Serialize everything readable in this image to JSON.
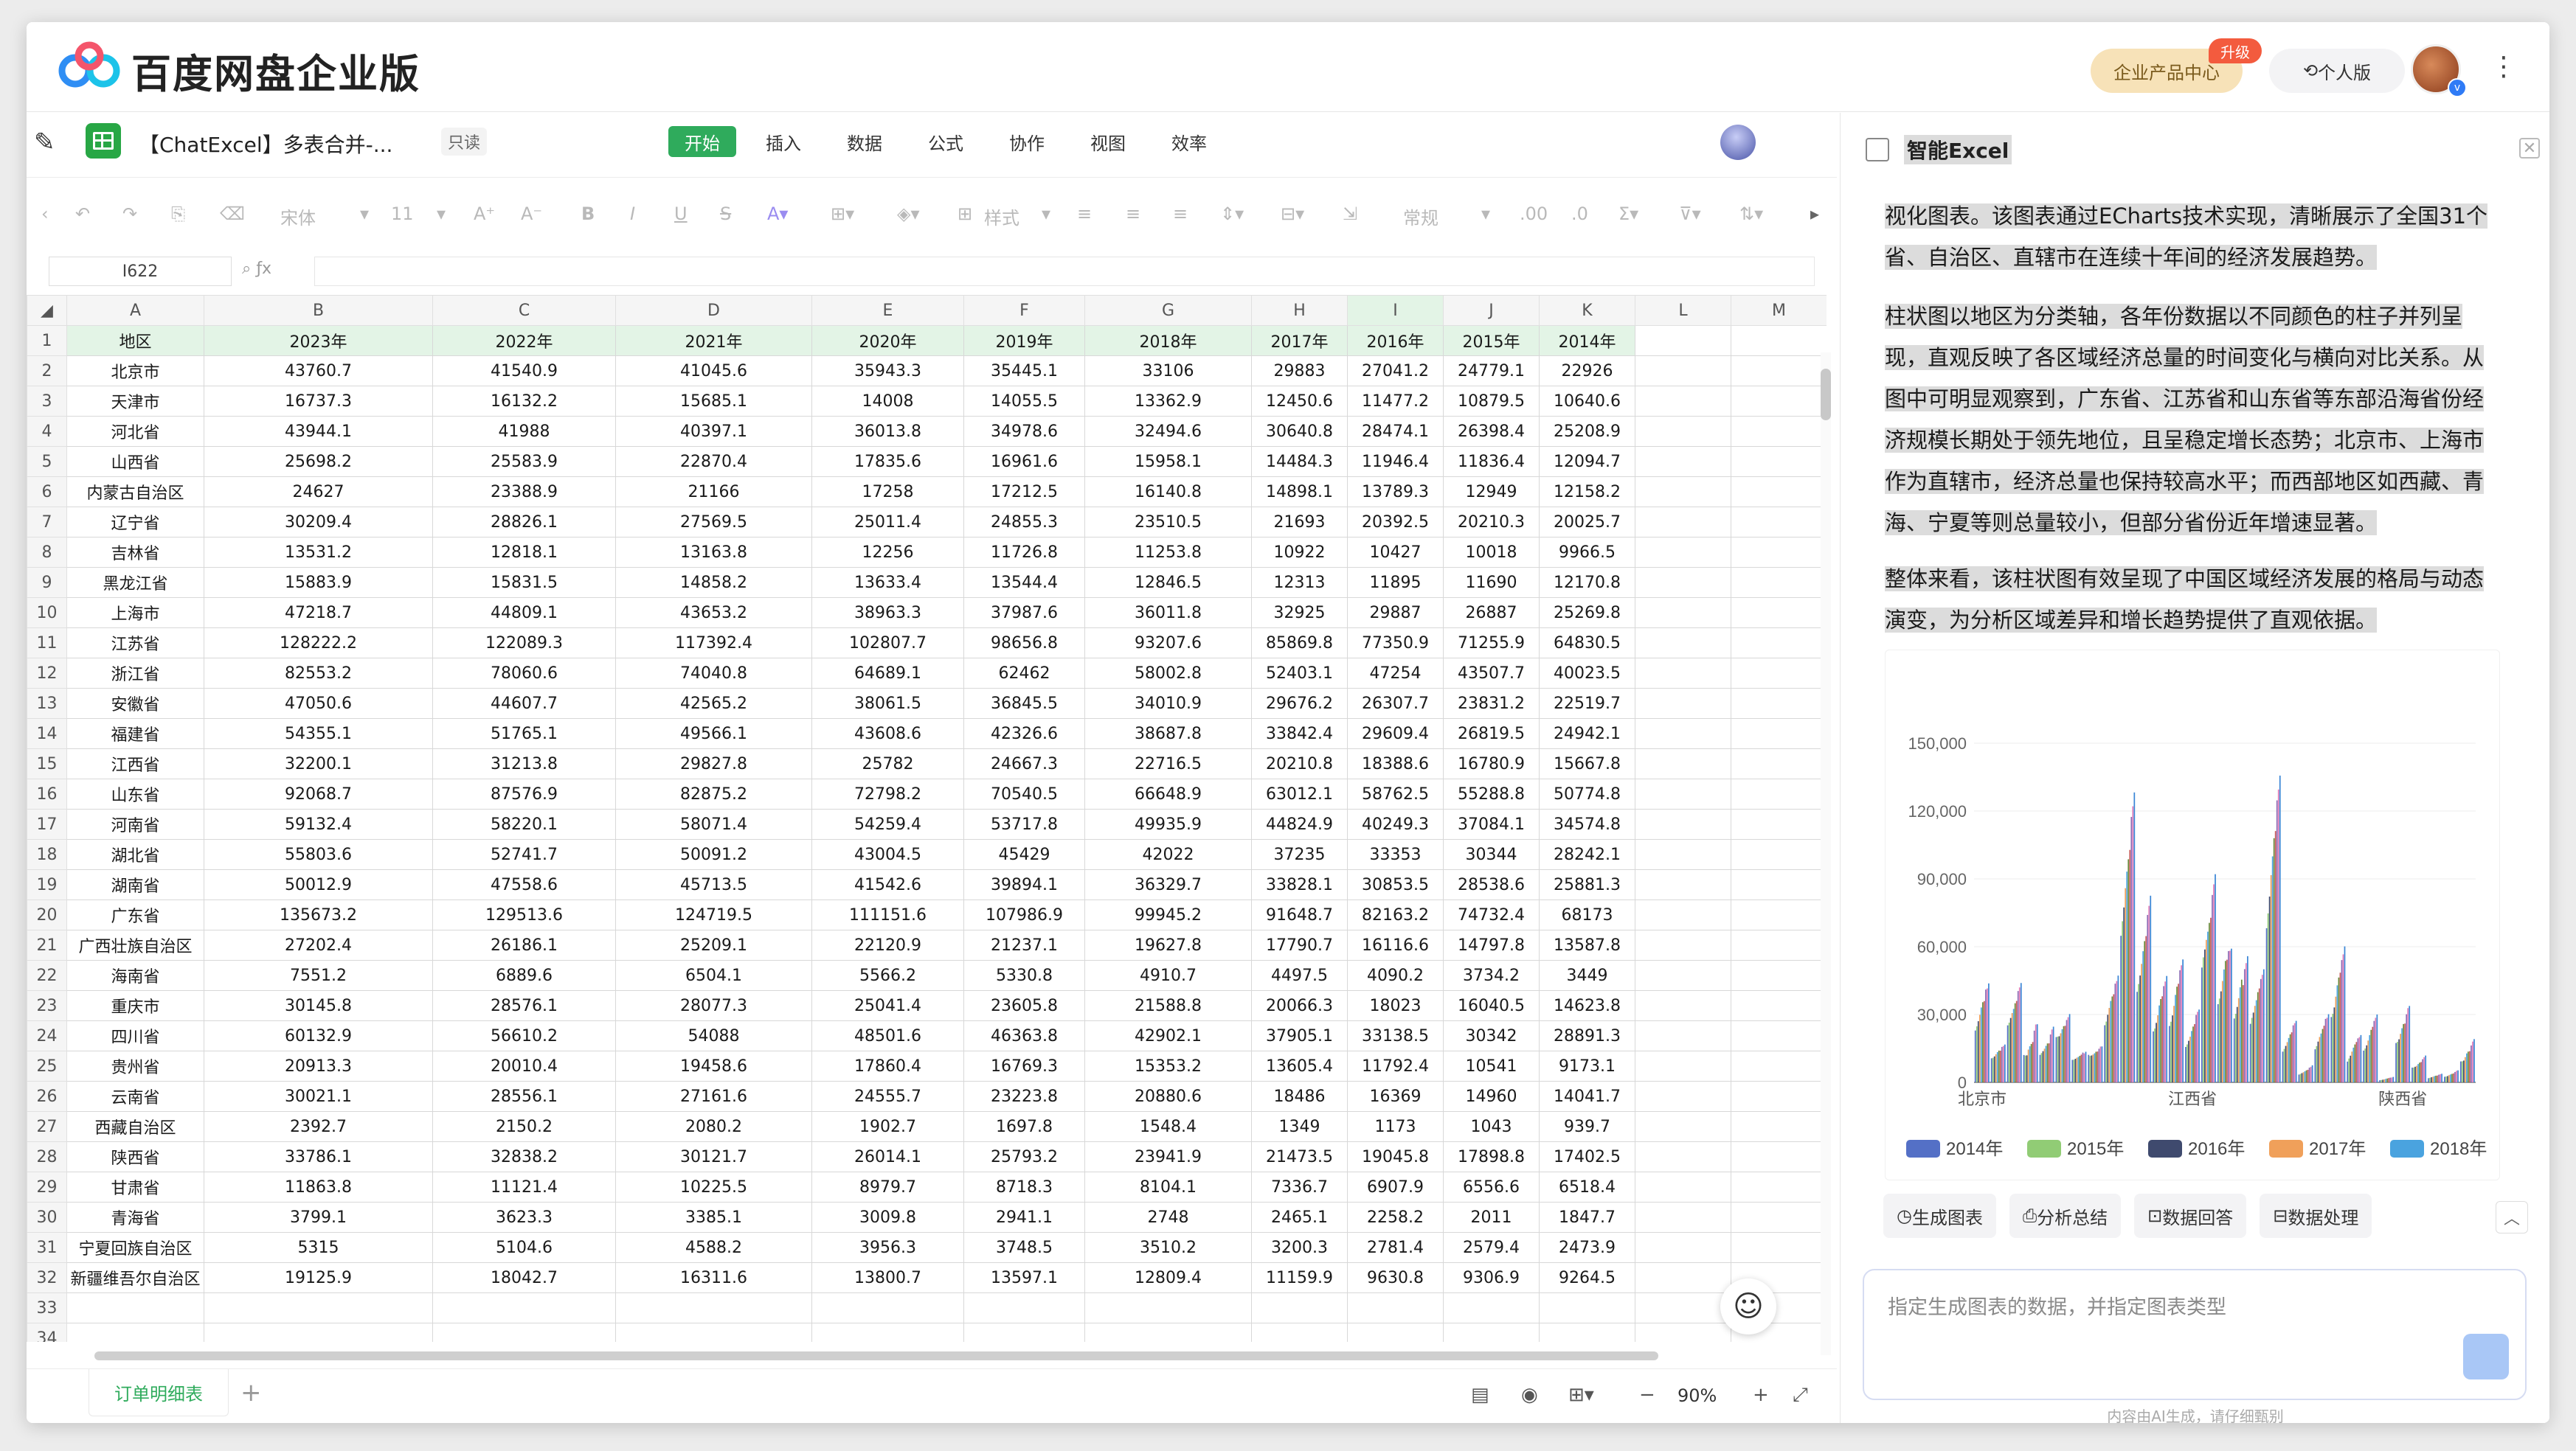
{
  "app": {
    "brand": "百度网盘企业版",
    "product_center": "企业产品中心",
    "upgrade": "升级",
    "personal": "个人版"
  },
  "doc": {
    "title": "【ChatExcel】多表合并-...",
    "readonly": "只读",
    "menu": [
      "开始",
      "插入",
      "数据",
      "公式",
      "协作",
      "视图",
      "效率"
    ],
    "active_menu": "开始"
  },
  "toolbar": {
    "font": "宋体",
    "size": "11",
    "style": "样式",
    "numfmt": "常规"
  },
  "formula": {
    "cell": "I622"
  },
  "grid": {
    "col_letters": [
      "A",
      "B",
      "C",
      "D",
      "E",
      "F",
      "G",
      "H",
      "I",
      "J",
      "K",
      "L",
      "M"
    ],
    "selected_col": "I",
    "header": [
      "地区",
      "2023年",
      "2022年",
      "2021年",
      "2020年",
      "2019年",
      "2018年",
      "2017年",
      "2016年",
      "2015年",
      "2014年"
    ],
    "rows": [
      [
        "北京市",
        "43760.7",
        "41540.9",
        "41045.6",
        "35943.3",
        "35445.1",
        "33106",
        "29883",
        "27041.2",
        "24779.1",
        "22926"
      ],
      [
        "天津市",
        "16737.3",
        "16132.2",
        "15685.1",
        "14008",
        "14055.5",
        "13362.9",
        "12450.6",
        "11477.2",
        "10879.5",
        "10640.6"
      ],
      [
        "河北省",
        "43944.1",
        "41988",
        "40397.1",
        "36013.8",
        "34978.6",
        "32494.6",
        "30640.8",
        "28474.1",
        "26398.4",
        "25208.9"
      ],
      [
        "山西省",
        "25698.2",
        "25583.9",
        "22870.4",
        "17835.6",
        "16961.6",
        "15958.1",
        "14484.3",
        "11946.4",
        "11836.4",
        "12094.7"
      ],
      [
        "内蒙古自治区",
        "24627",
        "23388.9",
        "21166",
        "17258",
        "17212.5",
        "16140.8",
        "14898.1",
        "13789.3",
        "12949",
        "12158.2"
      ],
      [
        "辽宁省",
        "30209.4",
        "28826.1",
        "27569.5",
        "25011.4",
        "24855.3",
        "23510.5",
        "21693",
        "20392.5",
        "20210.3",
        "20025.7"
      ],
      [
        "吉林省",
        "13531.2",
        "12818.1",
        "13163.8",
        "12256",
        "11726.8",
        "11253.8",
        "10922",
        "10427",
        "10018",
        "9966.5"
      ],
      [
        "黑龙江省",
        "15883.9",
        "15831.5",
        "14858.2",
        "13633.4",
        "13544.4",
        "12846.5",
        "12313",
        "11895",
        "11690",
        "12170.8"
      ],
      [
        "上海市",
        "47218.7",
        "44809.1",
        "43653.2",
        "38963.3",
        "37987.6",
        "36011.8",
        "32925",
        "29887",
        "26887",
        "25269.8"
      ],
      [
        "江苏省",
        "128222.2",
        "122089.3",
        "117392.4",
        "102807.7",
        "98656.8",
        "93207.6",
        "85869.8",
        "77350.9",
        "71255.9",
        "64830.5"
      ],
      [
        "浙江省",
        "82553.2",
        "78060.6",
        "74040.8",
        "64689.1",
        "62462",
        "58002.8",
        "52403.1",
        "47254",
        "43507.7",
        "40023.5"
      ],
      [
        "安徽省",
        "47050.6",
        "44607.7",
        "42565.2",
        "38061.5",
        "36845.5",
        "34010.9",
        "29676.2",
        "26307.7",
        "23831.2",
        "22519.7"
      ],
      [
        "福建省",
        "54355.1",
        "51765.1",
        "49566.1",
        "43608.6",
        "42326.6",
        "38687.8",
        "33842.4",
        "29609.4",
        "26819.5",
        "24942.1"
      ],
      [
        "江西省",
        "32200.1",
        "31213.8",
        "29827.8",
        "25782",
        "24667.3",
        "22716.5",
        "20210.8",
        "18388.6",
        "16780.9",
        "15667.8"
      ],
      [
        "山东省",
        "92068.7",
        "87576.9",
        "82875.2",
        "72798.2",
        "70540.5",
        "66648.9",
        "63012.1",
        "58762.5",
        "55288.8",
        "50774.8"
      ],
      [
        "河南省",
        "59132.4",
        "58220.1",
        "58071.4",
        "54259.4",
        "53717.8",
        "49935.9",
        "44824.9",
        "40249.3",
        "37084.1",
        "34574.8"
      ],
      [
        "湖北省",
        "55803.6",
        "52741.7",
        "50091.2",
        "43004.5",
        "45429",
        "42022",
        "37235",
        "33353",
        "30344",
        "28242.1"
      ],
      [
        "湖南省",
        "50012.9",
        "47558.6",
        "45713.5",
        "41542.6",
        "39894.1",
        "36329.7",
        "33828.1",
        "30853.5",
        "28538.6",
        "25881.3"
      ],
      [
        "广东省",
        "135673.2",
        "129513.6",
        "124719.5",
        "111151.6",
        "107986.9",
        "99945.2",
        "91648.7",
        "82163.2",
        "74732.4",
        "68173"
      ],
      [
        "广西壮族自治区",
        "27202.4",
        "26186.1",
        "25209.1",
        "22120.9",
        "21237.1",
        "19627.8",
        "17790.7",
        "16116.6",
        "14797.8",
        "13587.8"
      ],
      [
        "海南省",
        "7551.2",
        "6889.6",
        "6504.1",
        "5566.2",
        "5330.8",
        "4910.7",
        "4497.5",
        "4090.2",
        "3734.2",
        "3449"
      ],
      [
        "重庆市",
        "30145.8",
        "28576.1",
        "28077.3",
        "25041.4",
        "23605.8",
        "21588.8",
        "20066.3",
        "18023",
        "16040.5",
        "14623.8"
      ],
      [
        "四川省",
        "60132.9",
        "56610.2",
        "54088",
        "48501.6",
        "46363.8",
        "42902.1",
        "37905.1",
        "33138.5",
        "30342",
        "28891.3"
      ],
      [
        "贵州省",
        "20913.3",
        "20010.4",
        "19458.6",
        "17860.4",
        "16769.3",
        "15353.2",
        "13605.4",
        "11792.4",
        "10541",
        "9173.1"
      ],
      [
        "云南省",
        "30021.1",
        "28556.1",
        "27161.6",
        "24555.7",
        "23223.8",
        "20880.6",
        "18486",
        "16369",
        "14960",
        "14041.7"
      ],
      [
        "西藏自治区",
        "2392.7",
        "2150.2",
        "2080.2",
        "1902.7",
        "1697.8",
        "1548.4",
        "1349",
        "1173",
        "1043",
        "939.7"
      ],
      [
        "陕西省",
        "33786.1",
        "32838.2",
        "30121.7",
        "26014.1",
        "25793.2",
        "23941.9",
        "21473.5",
        "19045.8",
        "17898.8",
        "17402.5"
      ],
      [
        "甘肃省",
        "11863.8",
        "11121.4",
        "10225.5",
        "8979.7",
        "8718.3",
        "8104.1",
        "7336.7",
        "6907.9",
        "6556.6",
        "6518.4"
      ],
      [
        "青海省",
        "3799.1",
        "3623.3",
        "3385.1",
        "3009.8",
        "2941.1",
        "2748",
        "2465.1",
        "2258.2",
        "2011",
        "1847.7"
      ],
      [
        "宁夏回族自治区",
        "5315",
        "5104.6",
        "4588.2",
        "3956.3",
        "3748.5",
        "3510.2",
        "3200.3",
        "2781.4",
        "2579.4",
        "2473.9"
      ],
      [
        "新疆维吾尔自治区",
        "19125.9",
        "18042.7",
        "16311.6",
        "13800.7",
        "13597.1",
        "12809.4",
        "11159.9",
        "9630.8",
        "9306.9",
        "9264.5"
      ]
    ],
    "extra_rows": [
      "33",
      "34"
    ]
  },
  "sheet": {
    "tab": "订单明细表",
    "zoom": "90%"
  },
  "panel": {
    "title": "智能Excel",
    "p1": "视化图表。该图表通过ECharts技术实现，清晰展示了全国31个省、自治区、直辖市在连续十年间的经济发展趋势。",
    "p2": "柱状图以地区为分类轴，各年份数据以不同颜色的柱子并列呈现，直观反映了各区域经济总量的时间变化与横向对比关系。从图中可明显观察到，广东省、江苏省和山东省等东部沿海省份经济规模长期处于领先地位，且呈稳定增长态势；北京市、上海市作为直辖市，经济总量也保持较高水平；而西部地区如西藏、青海、宁夏等则总量较小，但部分省份近年增速显著。",
    "p3": "整体来看，该柱状图有效呈现了中国区域经济发展的格局与动态演变，为分析区域差异和增长趋势提供了直观依据。",
    "actions": [
      "生成图表",
      "分析总结",
      "数据回答",
      "数据处理"
    ],
    "input_placeholder": "指定生成图表的数据，并指定图表类型",
    "footer": "内容由AI生成，请仔细甄别"
  },
  "chart_data": {
    "type": "bar",
    "categories": [
      "北京市",
      "天津市",
      "河北省",
      "山西省",
      "内蒙古自治区",
      "辽宁省",
      "吉林省",
      "黑龙江省",
      "上海市",
      "江苏省",
      "浙江省",
      "安徽省",
      "福建省",
      "江西省",
      "山东省",
      "河南省",
      "湖北省",
      "湖南省",
      "广东省",
      "广西壮族自治区",
      "海南省",
      "重庆市",
      "四川省",
      "贵州省",
      "云南省",
      "西藏自治区",
      "陕西省",
      "甘肃省",
      "青海省",
      "宁夏回族自治区",
      "新疆维吾尔自治区"
    ],
    "x_tick_labels": [
      "北京市",
      "江西省",
      "陕西省"
    ],
    "ylim": [
      0,
      150000
    ],
    "yticks": [
      "0",
      "30,000",
      "60,000",
      "90,000",
      "120,000",
      "150,000"
    ],
    "legend_position": "bottom",
    "series": [
      {
        "name": "2014年",
        "color": "#5470c6",
        "values": [
          22926,
          10640.6,
          25208.9,
          12094.7,
          12158.2,
          20025.7,
          9966.5,
          12170.8,
          25269.8,
          64830.5,
          40023.5,
          22519.7,
          24942.1,
          15667.8,
          50774.8,
          34574.8,
          28242.1,
          25881.3,
          68173,
          13587.8,
          3449,
          14623.8,
          28891.3,
          9173.1,
          14041.7,
          939.7,
          17402.5,
          6518.4,
          1847.7,
          2473.9,
          9264.5
        ]
      },
      {
        "name": "2015年",
        "color": "#91cc75",
        "values": [
          24779.1,
          10879.5,
          26398.4,
          11836.4,
          12949,
          20210.3,
          10018,
          11690,
          26887,
          71255.9,
          43507.7,
          23831.2,
          26819.5,
          16780.9,
          55288.8,
          37084.1,
          30344,
          28538.6,
          74732.4,
          14797.8,
          3734.2,
          16040.5,
          30342,
          10541,
          14960,
          1043,
          17898.8,
          6556.6,
          2011,
          2579.4,
          9306.9
        ]
      },
      {
        "name": "2016年",
        "color": "#3f4a6e",
        "values": [
          27041.2,
          11477.2,
          28474.1,
          11946.4,
          13789.3,
          20392.5,
          10427,
          11895,
          29887,
          77350.9,
          47254,
          26307.7,
          29609.4,
          18388.6,
          58762.5,
          40249.3,
          33353,
          30853.5,
          82163.2,
          16116.6,
          4090.2,
          18023,
          33138.5,
          11792.4,
          16369,
          1173,
          19045.8,
          6907.9,
          2258.2,
          2781.4,
          9630.8
        ]
      },
      {
        "name": "2017年",
        "color": "#f0a05a",
        "values": [
          29883,
          12450.6,
          30640.8,
          14484.3,
          14898.1,
          21693,
          10922,
          12313,
          32925,
          85869.8,
          52403.1,
          29676.2,
          33842.4,
          20210.8,
          63012.1,
          44824.9,
          37235,
          33828.1,
          91648.7,
          17790.7,
          4497.5,
          20066.3,
          37905.1,
          13605.4,
          18486,
          1349,
          21473.5,
          7336.7,
          2465.1,
          3200.3,
          11159.9
        ]
      },
      {
        "name": "2018年",
        "color": "#4aa3df",
        "values": [
          33106,
          13362.9,
          32494.6,
          15958.1,
          16140.8,
          23510.5,
          11253.8,
          12846.5,
          36011.8,
          93207.6,
          58002.8,
          34010.9,
          38687.8,
          22716.5,
          66648.9,
          49935.9,
          42022,
          36329.7,
          99945.2,
          19627.8,
          4910.7,
          21588.8,
          42902.1,
          15353.2,
          20880.6,
          1548.4,
          23941.9,
          8104.1,
          2748,
          3510.2,
          12809.4
        ]
      },
      {
        "name": "2019年",
        "color": "#6a8a3a",
        "values": [
          35445.1,
          14055.5,
          34978.6,
          16961.6,
          17212.5,
          24855.3,
          11726.8,
          13544.4,
          37987.6,
          98656.8,
          62462,
          36845.5,
          42326.6,
          24667.3,
          70540.5,
          53717.8,
          45429,
          39894.1,
          107986.9,
          21237.1,
          5330.8,
          23605.8,
          46363.8,
          16769.3,
          23223.8,
          1697.8,
          25793.2,
          8718.3,
          2941.1,
          3748.5,
          13597.1
        ]
      },
      {
        "name": "2020年",
        "color": "#c55a5a",
        "values": [
          35943.3,
          14008,
          36013.8,
          17835.6,
          17258,
          25011.4,
          12256,
          13633.4,
          38963.3,
          102807.7,
          64689.1,
          38061.5,
          43608.6,
          25782,
          72798.2,
          54259.4,
          43004.5,
          41542.6,
          111151.6,
          22120.9,
          5566.2,
          25041.4,
          48501.6,
          17860.4,
          24555.7,
          1902.7,
          26014.1,
          8979.7,
          3009.8,
          3956.3,
          13800.7
        ]
      },
      {
        "name": "2021年",
        "color": "#8e6bb5",
        "values": [
          41045.6,
          15685.1,
          40397.1,
          22870.4,
          21166,
          27569.5,
          13163.8,
          14858.2,
          43653.2,
          117392.4,
          74040.8,
          42565.2,
          49566.1,
          29827.8,
          82875.2,
          58071.4,
          50091.2,
          45713.5,
          124719.5,
          25209.1,
          6504.1,
          28077.3,
          54088,
          19458.6,
          27161.6,
          2080.2,
          30121.7,
          10225.5,
          3385.1,
          4588.2,
          16311.6
        ]
      },
      {
        "name": "2022年",
        "color": "#e07bb8",
        "values": [
          41540.9,
          16132.2,
          41988,
          25583.9,
          23388.9,
          28826.1,
          12818.1,
          15831.5,
          44809.1,
          122089.3,
          78060.6,
          44607.7,
          51765.1,
          31213.8,
          87576.9,
          58220.1,
          52741.7,
          47558.6,
          129513.6,
          26186.1,
          6889.6,
          28576.1,
          56610.2,
          20010.4,
          28556.1,
          2150.2,
          32838.2,
          11121.4,
          3623.3,
          5104.6,
          18042.7
        ]
      },
      {
        "name": "2023年",
        "color": "#3a86d6",
        "values": [
          43760.7,
          16737.3,
          43944.1,
          25698.2,
          24627,
          30209.4,
          13531.2,
          15883.9,
          47218.7,
          128222.2,
          82553.2,
          47050.6,
          54355.1,
          32200.1,
          92068.7,
          59132.4,
          55803.6,
          50012.9,
          135673.2,
          27202.4,
          7551.2,
          30145.8,
          60132.9,
          20913.3,
          30021.1,
          2392.7,
          33786.1,
          11863.8,
          3799.1,
          5315,
          19125.9
        ]
      }
    ],
    "legend_visible": [
      "2014年",
      "2015年",
      "2016年",
      "2017年",
      "2018年"
    ]
  }
}
